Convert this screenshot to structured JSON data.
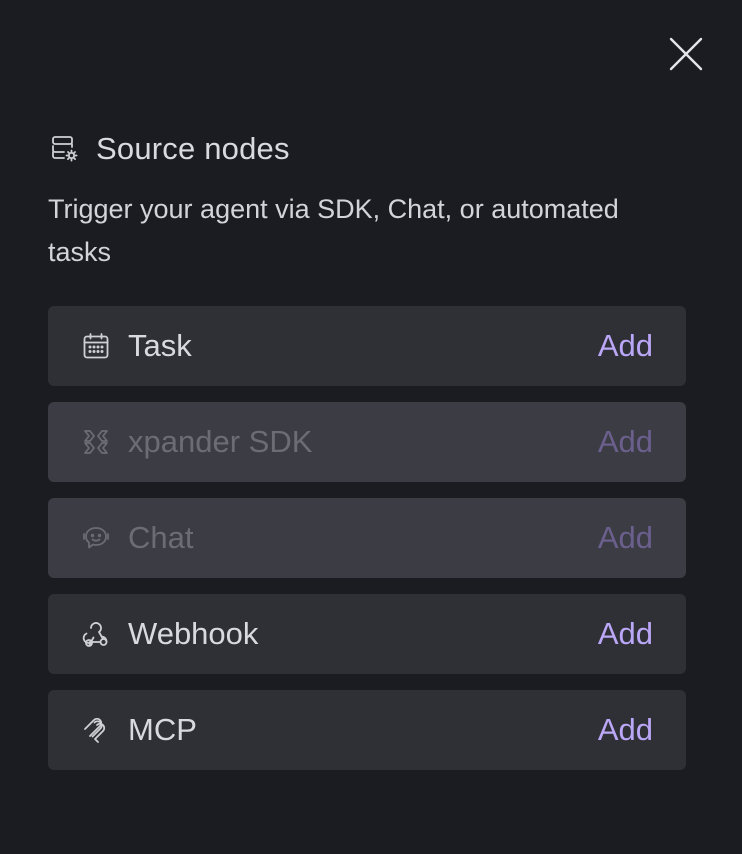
{
  "dialog": {
    "title": "Source nodes",
    "title_icon": "database-gear-icon",
    "subtitle": "Trigger your agent via SDK, Chat, or automated tasks",
    "close_icon": "close-icon"
  },
  "sources": [
    {
      "label": "Task",
      "icon": "calendar-icon",
      "action": "Add",
      "enabled": true
    },
    {
      "label": "xpander SDK",
      "icon": "xpander-logo-icon",
      "action": "Add",
      "enabled": false
    },
    {
      "label": "Chat",
      "icon": "chat-bot-icon",
      "action": "Add",
      "enabled": false
    },
    {
      "label": "Webhook",
      "icon": "webhook-icon",
      "action": "Add",
      "enabled": true
    },
    {
      "label": "MCP",
      "icon": "mcp-icon",
      "action": "Add",
      "enabled": true
    }
  ],
  "colors": {
    "background": "#1b1c21",
    "row": "#2f3036",
    "row_disabled": "#3c3d44",
    "accent": "#bba7f7"
  }
}
